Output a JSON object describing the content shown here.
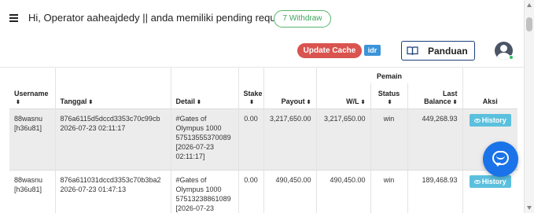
{
  "header": {
    "greeting": "Hi, Operator aaheajdedy || anda memiliki pending request:",
    "pending_pill": "7 Withdraw",
    "update_cache": "Update Cache",
    "currency": "idr",
    "guide": "Panduan",
    "icons": {
      "menu": "hamburger-icon",
      "guide": "book-icon",
      "user": "avatar-icon"
    }
  },
  "table": {
    "group_header": "Pemain",
    "columns": {
      "username": "Username",
      "tanggal": "Tanggal",
      "detail": "Detail",
      "stake": "Stake",
      "payout": "Payout",
      "wl": "W/L",
      "status": "Status",
      "last_balance": "Last Balance",
      "aksi": "Aksi"
    },
    "sort_glyph": "⬍",
    "rows": [
      {
        "username": "88wasnu [h36u81]",
        "tanggal_id": "876a6115d5dccd3353c70c99cb",
        "tanggal_time": "2026-07-23 02:11:17",
        "detail": "#Gates of Olympus 1000 57513555370089 [2026-07-23 02:11:17]",
        "stake": "0.00",
        "payout": "3,217,650.00",
        "wl": "3,217,650.00",
        "status": "win",
        "last_balance": "449,268.93",
        "action": "History"
      },
      {
        "username": "88wasnu [h36u81]",
        "tanggal_id": "876a611031dccd3353c70b3ba2",
        "tanggal_time": "2026-07-23 01:47:13",
        "detail": "#Gates of Olympus 1000 57513238861089 [2026-07-23",
        "stake": "0.00",
        "payout": "490,450.00",
        "wl": "490,450.00",
        "status": "win",
        "last_balance": "189,468.93",
        "action": "History"
      }
    ]
  },
  "colors": {
    "update_cache_bg": "#d9534f",
    "idr_bg": "#3b94d9",
    "history_bg": "#5bc0de",
    "withdraw_pill": "#56b36b",
    "chat_bg": "#1a73e8",
    "selected_row_bg": "#ececec"
  }
}
